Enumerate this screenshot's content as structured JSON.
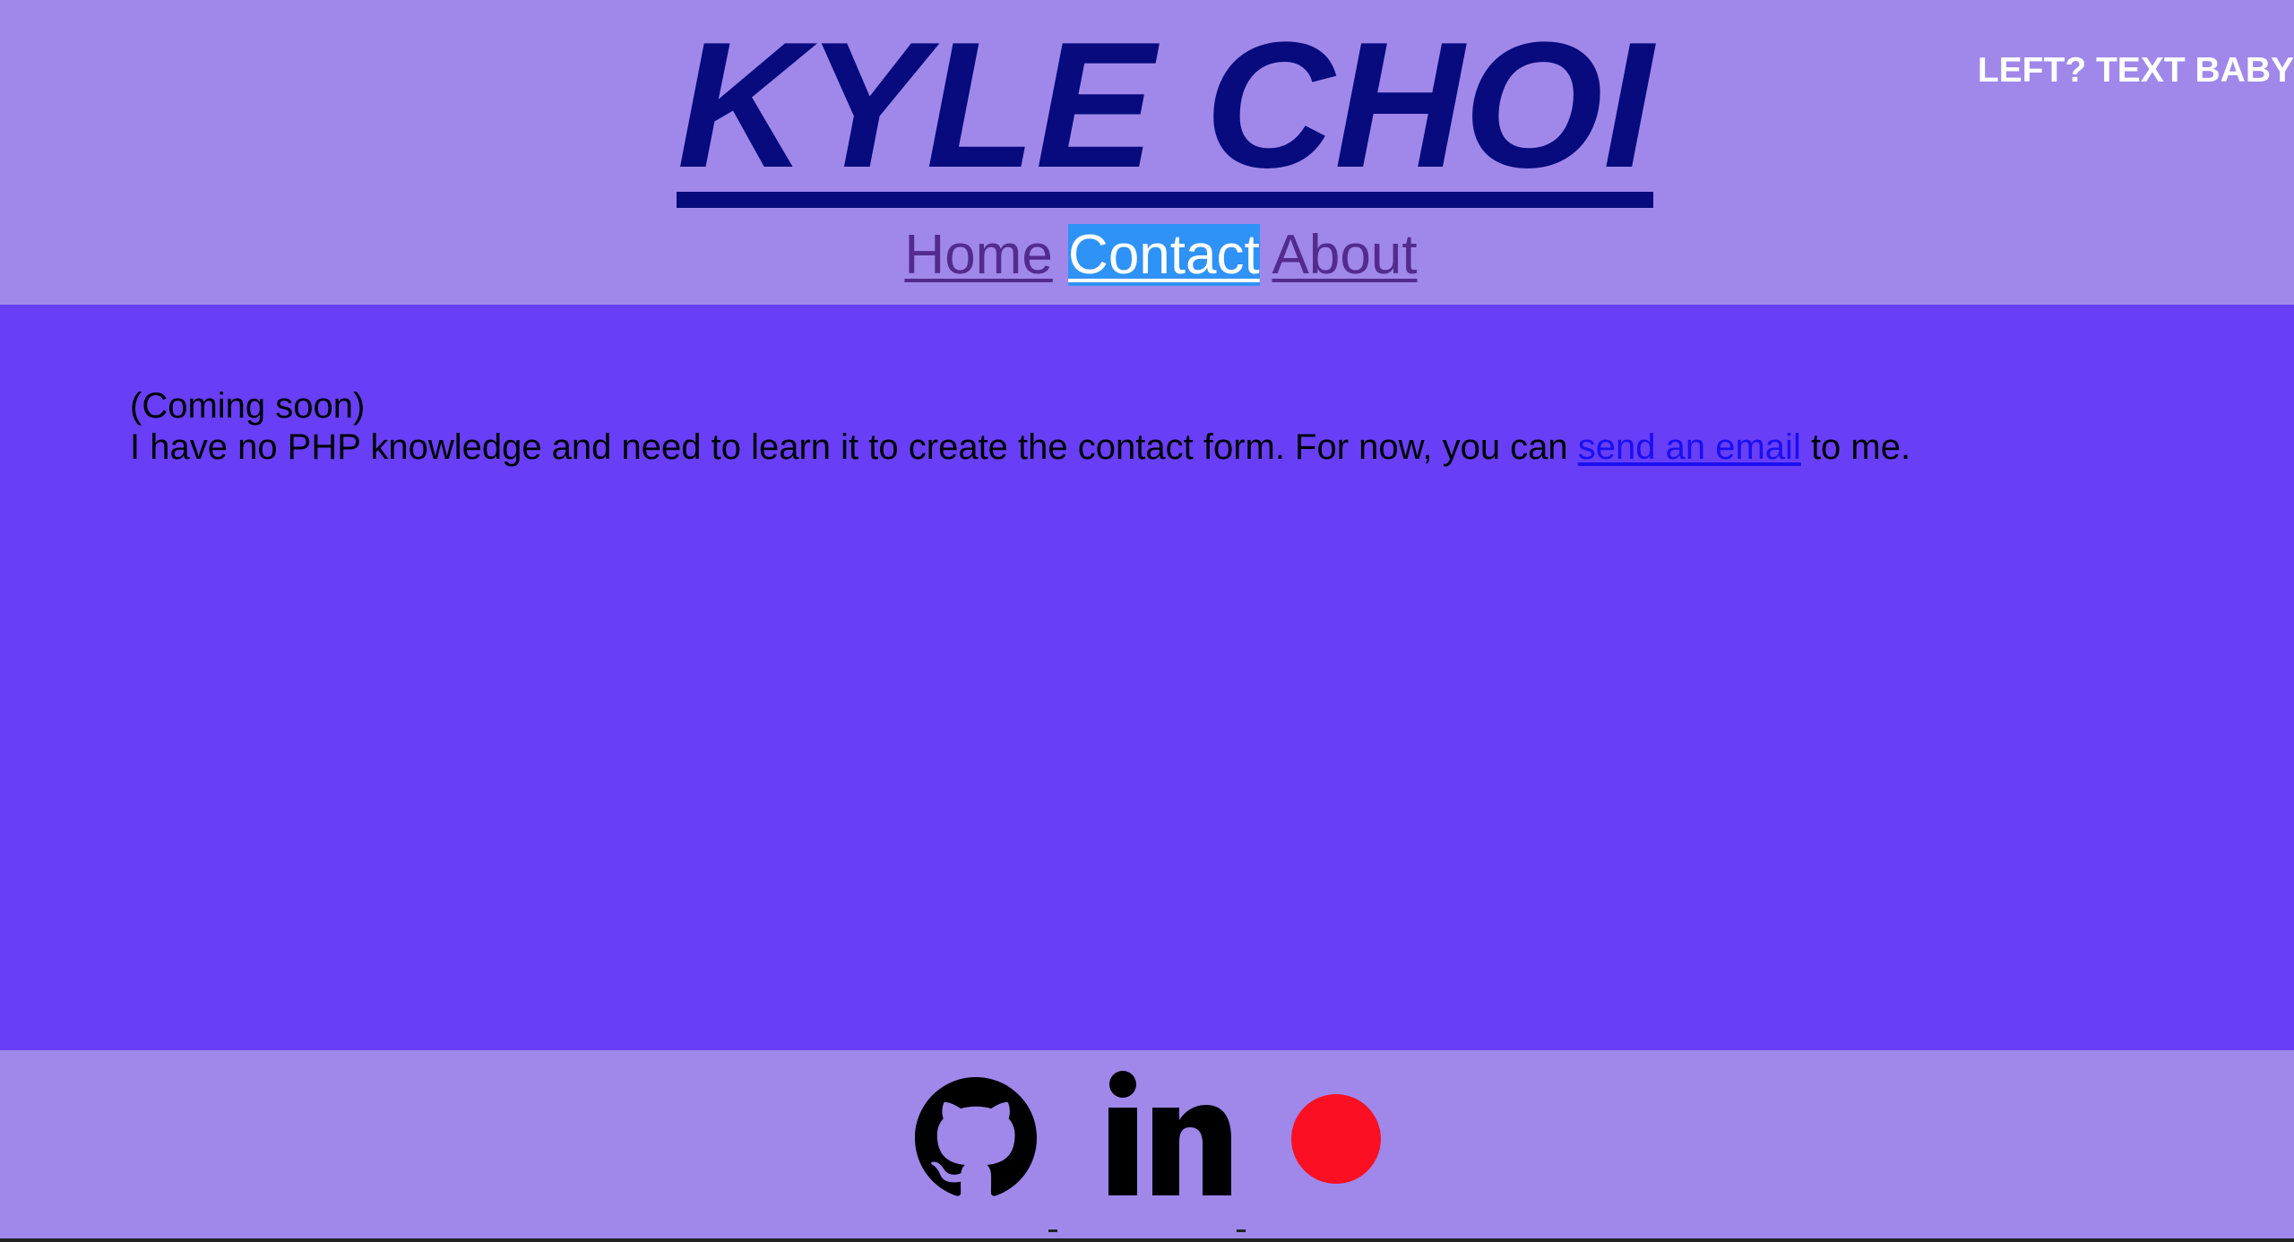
{
  "header": {
    "title": "KYLE CHOI",
    "corner_text": "LEFT? TEXT BABY",
    "nav": {
      "home": "Home",
      "contact": "Contact",
      "about": "About",
      "selected": "contact"
    }
  },
  "main": {
    "line1": "(Coming soon)",
    "line2_before": "I have no PHP knowledge and need to learn it to create the contact form. For now, you can ",
    "email_link": "send an email",
    "line2_after": " to me."
  },
  "footer": {
    "icons": [
      "github-icon",
      "linkedin-icon",
      "red-circle-icon"
    ]
  },
  "colors": {
    "header_bg": "#9f88ea",
    "main_bg": "#683ff6",
    "title": "#070b7d",
    "nav_link": "#532b8f",
    "nav_selected_bg": "#2f92f6",
    "email_link": "#1a0ff2",
    "record_dot": "#fb0f22"
  }
}
